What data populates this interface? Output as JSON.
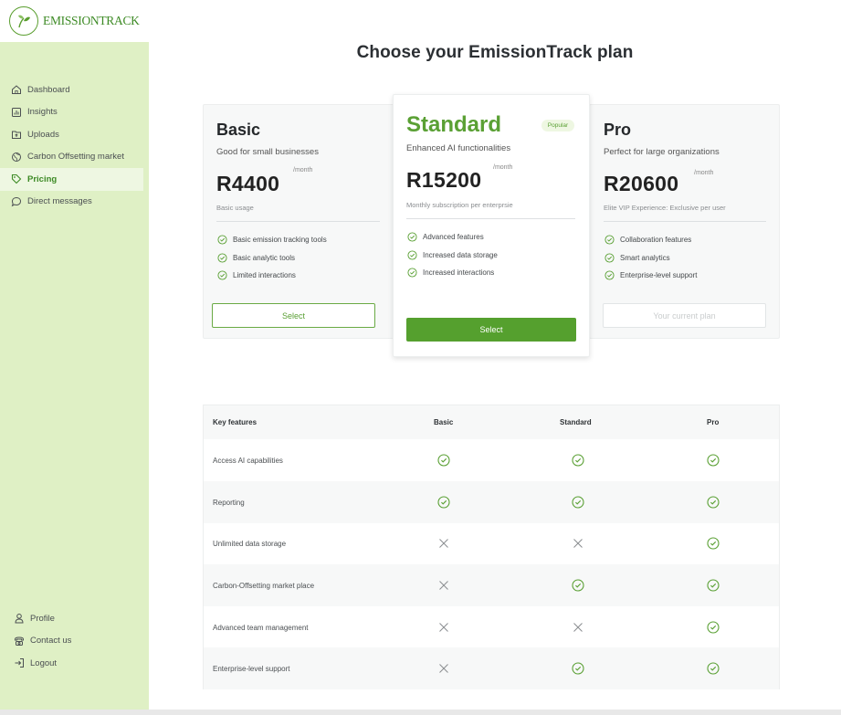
{
  "brand": {
    "name": "EMISSIONTRACK",
    "accent": "#55a02e",
    "sidebar_bg": "#dff0c5"
  },
  "sidebar": {
    "items": [
      {
        "label": "Dashboard",
        "icon": "home-icon"
      },
      {
        "label": "Insights",
        "icon": "chart-icon"
      },
      {
        "label": "Uploads",
        "icon": "upload-icon"
      },
      {
        "label": "Carbon Offsetting market",
        "icon": "globe-icon"
      },
      {
        "label": "Pricing",
        "icon": "tag-icon",
        "active": true
      },
      {
        "label": "Direct messages",
        "icon": "chat-icon"
      }
    ],
    "bottom": [
      {
        "label": "Profile",
        "icon": "user-icon"
      },
      {
        "label": "Contact us",
        "icon": "phone-icon"
      },
      {
        "label": "Logout",
        "icon": "logout-icon"
      }
    ]
  },
  "page": {
    "title": "Choose your EmissionTrack plan"
  },
  "plans": {
    "basic": {
      "name": "Basic",
      "subtitle": "Good for small businesses",
      "price": "R4400",
      "per": "/month",
      "note": "Basic usage",
      "features": [
        "Basic  emission tracking tools",
        "Basic analytic tools",
        "Limited interactions"
      ],
      "button": "Select"
    },
    "standard": {
      "name": "Standard",
      "badge": "Popular",
      "subtitle": "Enhanced AI functionalities",
      "price": "R15200",
      "per": "/month",
      "note": "Monthly subscription per enterprsie",
      "features": [
        "Advanced features",
        "Increased data storage",
        "Increased interactions"
      ],
      "button": "Select"
    },
    "pro": {
      "name": "Pro",
      "subtitle": "Perfect for large organizations",
      "price": "R20600",
      "per": "/month",
      "note": "Elite VIP Experience: Exclusive per user",
      "features": [
        "Collaboration features",
        "Smart analytics",
        "Enterprise-level support"
      ],
      "button": "Your current plan"
    }
  },
  "comparison": {
    "headers": [
      "Key features",
      "Basic",
      "Standard",
      "Pro"
    ],
    "rows": [
      {
        "feature": "Access AI capabilities",
        "basic": true,
        "standard": true,
        "pro": true
      },
      {
        "feature": "Reporting",
        "basic": true,
        "standard": true,
        "pro": true
      },
      {
        "feature": "Unlimited data storage",
        "basic": false,
        "standard": false,
        "pro": true
      },
      {
        "feature": "Carbon-Offsetting market place",
        "basic": false,
        "standard": true,
        "pro": true
      },
      {
        "feature": "Advanced team management",
        "basic": false,
        "standard": false,
        "pro": true
      },
      {
        "feature": "Enterprise-level support",
        "basic": false,
        "standard": true,
        "pro": true
      }
    ]
  }
}
